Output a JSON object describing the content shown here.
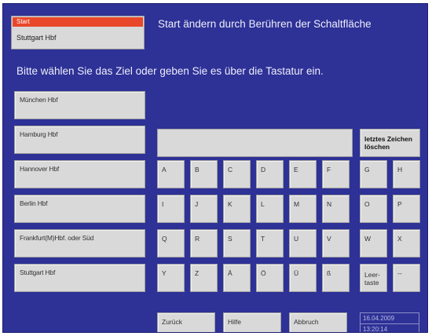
{
  "start": {
    "label": "Start",
    "value": "Stuttgart Hbf",
    "hint": "Start ändern durch Berühren der Schaltfläche"
  },
  "prompt": "Bitte wählen Sie das Ziel oder geben Sie es über die Tastatur ein.",
  "destinations": [
    "München Hbf",
    "Hamburg Hbf",
    "Hannover Hbf",
    "Berlin Hbf",
    "Frankfurt(M)Hbf. oder Süd",
    "Stuttgart Hbf"
  ],
  "entry_value": "",
  "delete_label": "letztes Zeichen löschen",
  "keys": [
    [
      "A",
      "B",
      "C",
      "D",
      "E",
      "F",
      "G",
      "H"
    ],
    [
      "I",
      "J",
      "K",
      "L",
      "M",
      "N",
      "O",
      "P"
    ],
    [
      "Q",
      "R",
      "S",
      "T",
      "U",
      "V",
      "W",
      "X"
    ],
    [
      "Y",
      "Z",
      "Ä",
      "Ö",
      "Ü",
      "ß",
      "Leer-\ntaste",
      "--"
    ]
  ],
  "footer": {
    "back": "Zurück",
    "help": "Hilfe",
    "cancel": "Abbruch",
    "date": "16.04.2009",
    "time": "13:20:14"
  },
  "colors": {
    "background": "#2e3196",
    "button": "#d9d9d9",
    "start_label": "#e8472a"
  }
}
